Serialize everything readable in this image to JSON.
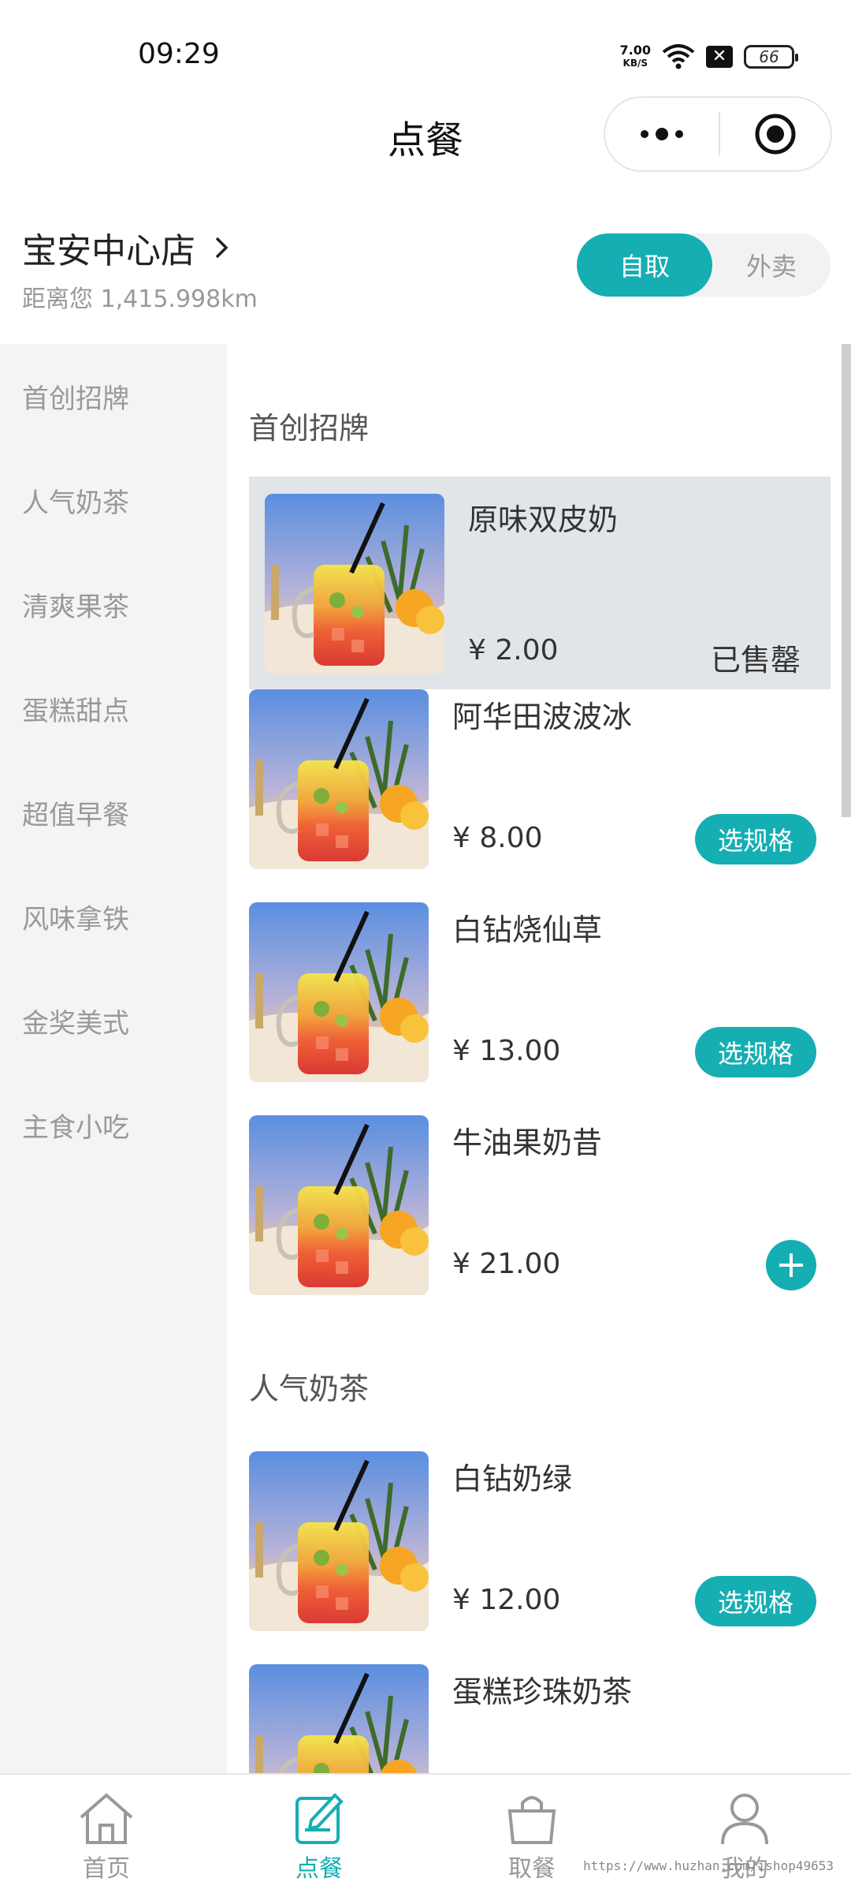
{
  "status_bar": {
    "time": "09:29",
    "net_speed_value": "7.00",
    "net_speed_unit": "KB/S",
    "battery": "66"
  },
  "nav": {
    "title": "点餐"
  },
  "store": {
    "name": "宝安中心店",
    "distance": "距离您 1,415.998km",
    "modes": {
      "active": "自取",
      "inactive": "外卖"
    }
  },
  "categories": [
    "首创招牌",
    "人气奶茶",
    "清爽果茶",
    "蛋糕甜点",
    "超值早餐",
    "风味拿铁",
    "金奖美式",
    "主食小吃"
  ],
  "sections": [
    {
      "title": "首创招牌",
      "products": [
        {
          "name": "原味双皮奶",
          "price": "¥ 2.00",
          "status": "已售罄"
        },
        {
          "name": "阿华田波波冰",
          "price": "¥ 8.00",
          "action": "选规格"
        },
        {
          "name": "白钻烧仙草",
          "price": "¥ 13.00",
          "action": "选规格"
        },
        {
          "name": "牛油果奶昔",
          "price": "¥ 21.00"
        }
      ]
    },
    {
      "title": "人气奶茶",
      "products": [
        {
          "name": "白钻奶绿",
          "price": "¥ 12.00",
          "action": "选规格"
        },
        {
          "name": "蛋糕珍珠奶茶",
          "price": ""
        }
      ]
    }
  ],
  "tabbar": {
    "items": [
      {
        "label": "首页",
        "icon": "home-icon"
      },
      {
        "label": "点餐",
        "icon": "order-icon"
      },
      {
        "label": "取餐",
        "icon": "bag-icon"
      },
      {
        "label": "我的",
        "icon": "user-icon"
      }
    ],
    "active_index": 1
  },
  "watermark": "https://www.huzhan.com/ishop49653",
  "colors": {
    "accent": "#15aeb3",
    "sidebar_bg": "#f4f4f4",
    "soldout_bg": "#e2e5e8"
  }
}
